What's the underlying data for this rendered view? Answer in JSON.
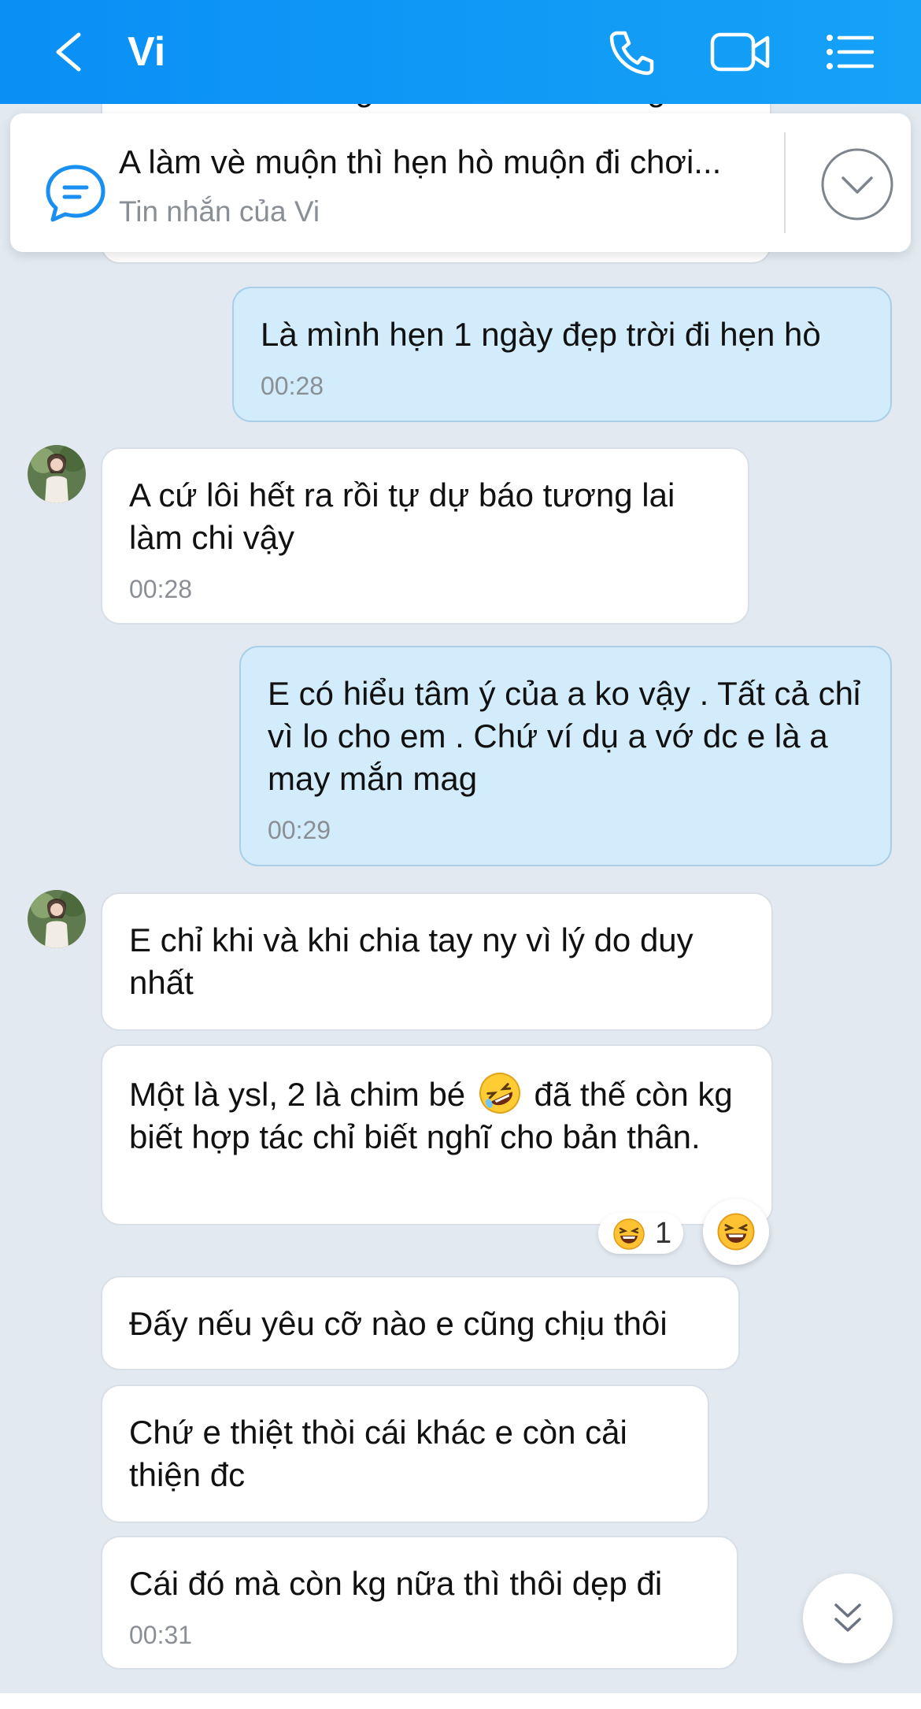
{
  "header": {
    "title": "Vi",
    "icons": [
      "back-arrow-icon",
      "phone-icon",
      "video-call-icon",
      "menu-list-icon"
    ],
    "background": "#0a8ff5"
  },
  "pinned": {
    "text": "A làm vè muộn thì hẹn hò muộn đi chơi...",
    "sub": "Tin nhắn của Vi",
    "icon": "message-icon"
  },
  "partial_message": {
    "text": "Cho dù còn ư kg dư vk mới đi chung"
  },
  "messages": [
    {
      "side": "out",
      "text": "Là mình hẹn 1 ngày đẹp trời đi hẹn hò",
      "time": "00:28"
    },
    {
      "side": "in",
      "text": "A cứ lôi hết ra rồi tự dự báo tương lai làm chi vậy",
      "time": "00:28"
    },
    {
      "side": "out",
      "text": "E có hiểu tâm ý của a ko vậy . Tất cả chỉ vì lo cho em . Chứ ví dụ a vớ dc e là a may mắn mag",
      "time": "00:29"
    },
    {
      "side": "in",
      "text": "E chỉ khi và khi chia tay ny vì lý do duy nhất"
    },
    {
      "side": "in",
      "text_before": "Một là ysl, 2 là chim bé",
      "emoji": "rolling-laughing-emoji",
      "text_after": "đã thế còn kg biết hợp tác chỉ biết nghĩ cho bản thân."
    },
    {
      "side": "in",
      "text": "Đấy nếu yêu cỡ nào e cũng chịu thôi"
    },
    {
      "side": "in",
      "text": "Chứ e thiệt thòi cái khác e còn cải thiện đc"
    },
    {
      "side": "in",
      "text": "Cái đó mà còn kg nữa thì thôi dẹp đi",
      "time": "00:31"
    }
  ],
  "reaction": {
    "emoji": "laughing-emoji",
    "count": "1"
  },
  "scroll_button": {
    "icon": "double-chevron-down-icon"
  },
  "colors": {
    "chat_background": "#e2e9f1",
    "outgoing_bubble": "#d2ecfb",
    "incoming_bubble": "#ffffff"
  }
}
